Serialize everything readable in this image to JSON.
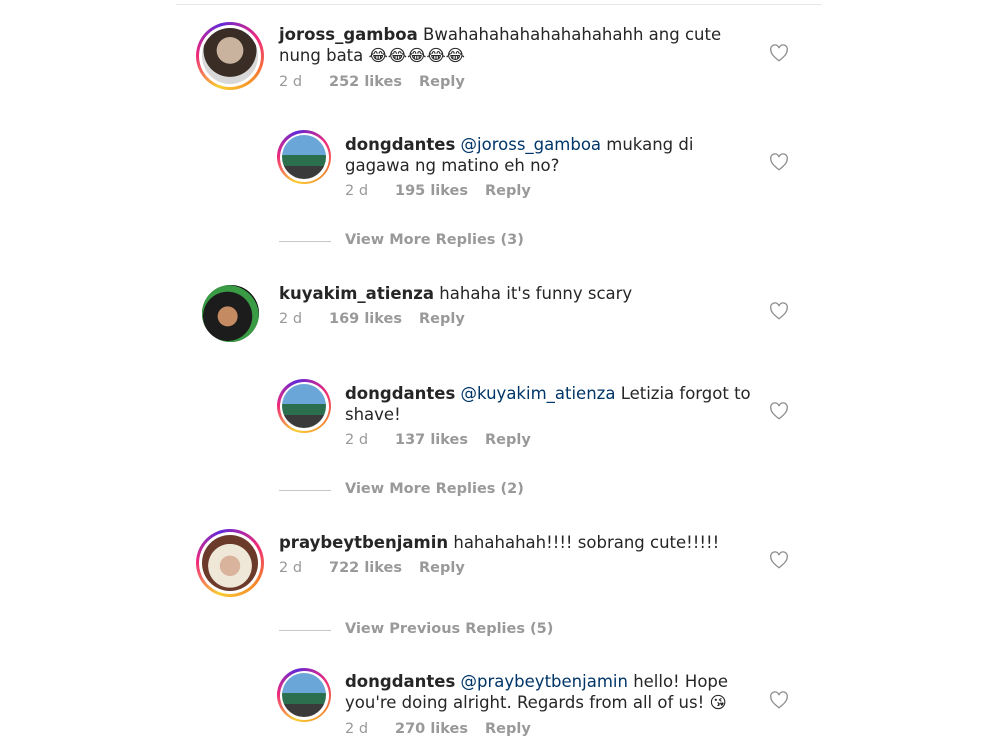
{
  "comments": [
    {
      "username": "joross_gamboa",
      "text": "Bwahahahahahahahahahh ang cute nung bata",
      "emoji": "😂😂😂😂😂",
      "time": "2 d",
      "likes": "252 likes",
      "reply": "Reply"
    },
    {
      "username": "dongdantes",
      "mention": "@joross_gamboa",
      "text": "mukang di gagawa ng matino eh no?",
      "time": "2 d",
      "likes": "195 likes",
      "reply": "Reply"
    },
    {
      "more": "View More Replies (3)"
    },
    {
      "username": "kuyakim_atienza",
      "text": "hahaha it's funny scary",
      "time": "2 d",
      "likes": "169 likes",
      "reply": "Reply"
    },
    {
      "username": "dongdantes",
      "mention": "@kuyakim_atienza",
      "text": "Letizia forgot to shave!",
      "time": "2 d",
      "likes": "137 likes",
      "reply": "Reply"
    },
    {
      "more": "View More Replies (2)"
    },
    {
      "username": "praybeytbenjamin",
      "text": "hahahahah!!!! sobrang cute!!!!!",
      "time": "2 d",
      "likes": "722 likes",
      "reply": "Reply"
    },
    {
      "more": "View Previous Replies (5)"
    },
    {
      "username": "dongdantes",
      "mention": "@praybeytbenjamin",
      "text": "hello! Hope you're doing alright. Regards from all of us!",
      "emoji": "😘",
      "time": "2 d",
      "likes": "270 likes",
      "reply": "Reply"
    }
  ],
  "colors": {
    "text": "#262626",
    "muted": "#999999",
    "mention": "#003569"
  },
  "icons": {
    "like": "heart-outline-icon"
  }
}
